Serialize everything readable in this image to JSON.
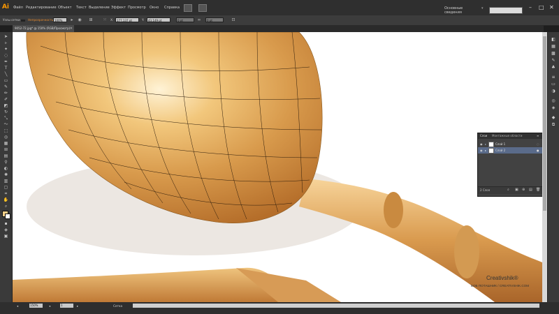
{
  "app": {
    "logo": "Ai",
    "workspace": "Основные сведения",
    "workspace_arrow": "▾"
  },
  "menu": [
    "Файл",
    "Редактирование",
    "Объект",
    "Текст",
    "Выделение",
    "Эффект",
    "Просмотр",
    "Окно",
    "Справка"
  ],
  "window_controls": {
    "minimize": "–",
    "maximize": "□",
    "close": "✕"
  },
  "control_bar": {
    "selection_label": "Узлы сетки",
    "opacity_label": "Непрозрачность",
    "opacity_value": "100%",
    "x_label": "X:",
    "x_value": "177,137 pt",
    "y_label": "Y:",
    "y_value": "43,149 pt",
    "w_value": "0 pt",
    "h_value": "0 pt"
  },
  "document": {
    "tab_title": "9052-72.jpg* @ 150% (RGB/Просмотр)",
    "close": "✕"
  },
  "status_bar": {
    "zoom": "150%",
    "page": "1",
    "tool_label": "Сетка",
    "nav_prev": "◂",
    "nav_next": "▸"
  },
  "layers_panel": {
    "tabs": [
      "Слои",
      "Монтажные области"
    ],
    "rows": [
      {
        "name": "Слой 1"
      },
      {
        "name": "Слой 2"
      }
    ],
    "footer_count": "2 Слоя"
  },
  "watermark": {
    "title": "Creativshik®",
    "subtitle": "БОБ ПОТАШНИК / CREATIVSHIK.COM"
  },
  "colors": {
    "accent": "#ff9a00",
    "chrome": "#3c3c3c",
    "canvas": "#ffffff",
    "gold": "#e0a85a"
  },
  "icons": {
    "tools": [
      "selection-tool-icon",
      "direct-selection-tool-icon",
      "magic-wand-icon",
      "lasso-icon",
      "pen-tool-icon",
      "type-tool-icon",
      "line-tool-icon",
      "rectangle-tool-icon",
      "paintbrush-icon",
      "pencil-icon",
      "blob-brush-icon",
      "eraser-icon",
      "rotate-icon",
      "scale-icon",
      "warp-icon",
      "free-transform-icon",
      "shape-builder-icon",
      "perspective-grid-icon",
      "mesh-tool-icon",
      "gradient-tool-icon",
      "eyedropper-icon",
      "blend-tool-icon",
      "symbol-sprayer-icon",
      "column-graph-icon",
      "artboard-tool-icon",
      "slice-tool-icon",
      "hand-tool-icon",
      "zoom-tool-icon"
    ],
    "dock": [
      "color-panel-icon",
      "color-guide-icon",
      "swatches-icon",
      "brushes-icon",
      "symbols-icon",
      "stroke-icon",
      "gradient-panel-icon",
      "transparency-icon",
      "appearance-icon",
      "graphic-styles-icon",
      "layers-icon",
      "artboards-icon"
    ]
  }
}
